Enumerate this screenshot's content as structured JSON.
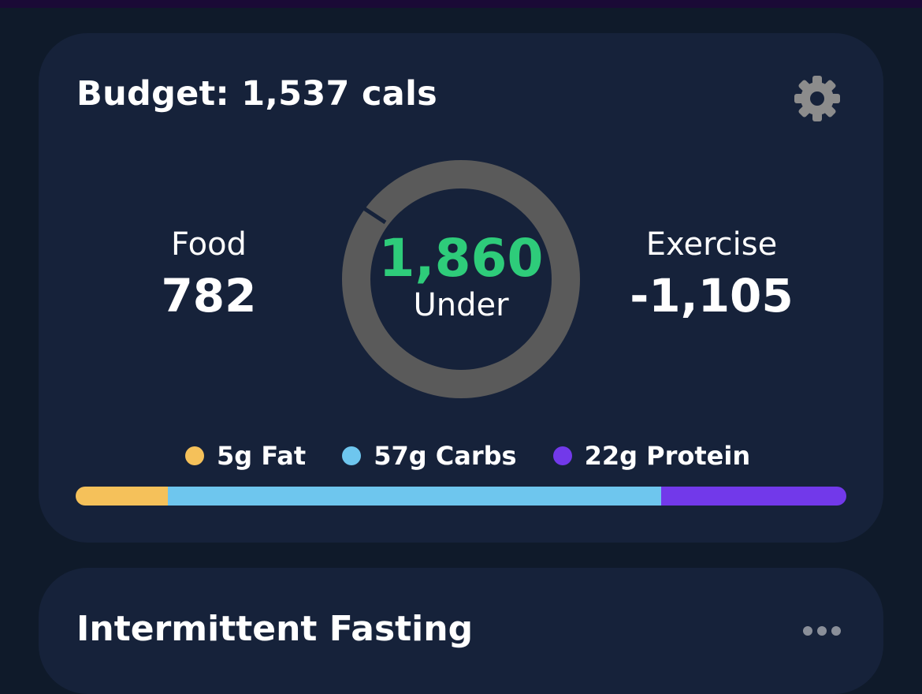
{
  "budget": {
    "title": "Budget: 1,537 cals",
    "settings_icon": "gear-icon",
    "food": {
      "label": "Food",
      "value": "782"
    },
    "exercise": {
      "label": "Exercise",
      "value": "-1,105"
    },
    "ring": {
      "value": "1,860",
      "label": "Under",
      "value_color": "#2ecc7a",
      "track_color": "#5a5a5a"
    },
    "macros": [
      {
        "label": "5g Fat",
        "color": "#f5c15a",
        "share": 0.12
      },
      {
        "label": "57g Carbs",
        "color": "#6ec6ee",
        "share": 0.64
      },
      {
        "label": "22g Protein",
        "color": "#7239ea",
        "share": 0.24
      }
    ]
  },
  "fasting": {
    "title": "Intermittent Fasting",
    "more_icon": "more-horizontal-icon"
  }
}
